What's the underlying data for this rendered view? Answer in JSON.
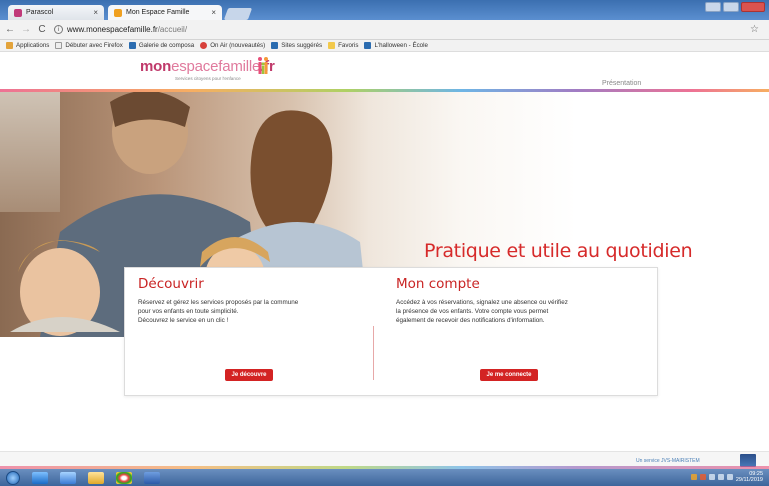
{
  "browser": {
    "tabs": [
      {
        "label": "Parascol",
        "favicon_color": "#c0397a"
      },
      {
        "label": "Mon Espace Famille",
        "favicon_color": "#f0a020"
      }
    ],
    "url": {
      "host": "www.monespacefamille.fr",
      "path": "/accueil/"
    },
    "bookmarks": [
      {
        "label": "Applications",
        "icon_color": "#e3a33b"
      },
      {
        "label": "Débuter avec Firefox",
        "icon_color": "#eeeeee"
      },
      {
        "label": "Galerie de composa",
        "icon_color": "#2b6cb0"
      },
      {
        "label": "On Air (nouveautés)",
        "icon_color": "#d7403a"
      },
      {
        "label": "Sites suggérés",
        "icon_color": "#2b6cb0"
      },
      {
        "label": "Favoris",
        "icon_color": "#f2c94c"
      },
      {
        "label": "L'halloween - École",
        "icon_color": "#2b6cb0"
      }
    ]
  },
  "site": {
    "logo": {
      "part1": "mon",
      "part2": "espace",
      "part3": "famille",
      "tld": ".fr"
    },
    "tagline": "Services citoyens pour l'enfance",
    "nav": {
      "presentation": "Présentation"
    },
    "hero_title": "Pratique et utile au quotidien",
    "discover": {
      "title": "Découvrir",
      "line1": "Réservez et gérez les services proposés par la commune",
      "line2": "pour vos enfants en toute simplicité.",
      "line3": "Découvrez le service en un clic !",
      "button": "Je découvre"
    },
    "account": {
      "title": "Mon compte",
      "line1": "Accédez à vos réservations, signalez une absence ou vérifiez",
      "line2": "la présence de vos enfants. Votre compte vous permet",
      "line3": "également de recevoir des notifications d'information.",
      "button": "Je me connecte"
    },
    "footer_credit": "Un service JVS-MAIRISTEM"
  },
  "taskbar": {
    "time": "09:25",
    "date": "29/11/2019"
  },
  "colors": {
    "accent": "#d32323",
    "brand": "#c03a6b"
  }
}
